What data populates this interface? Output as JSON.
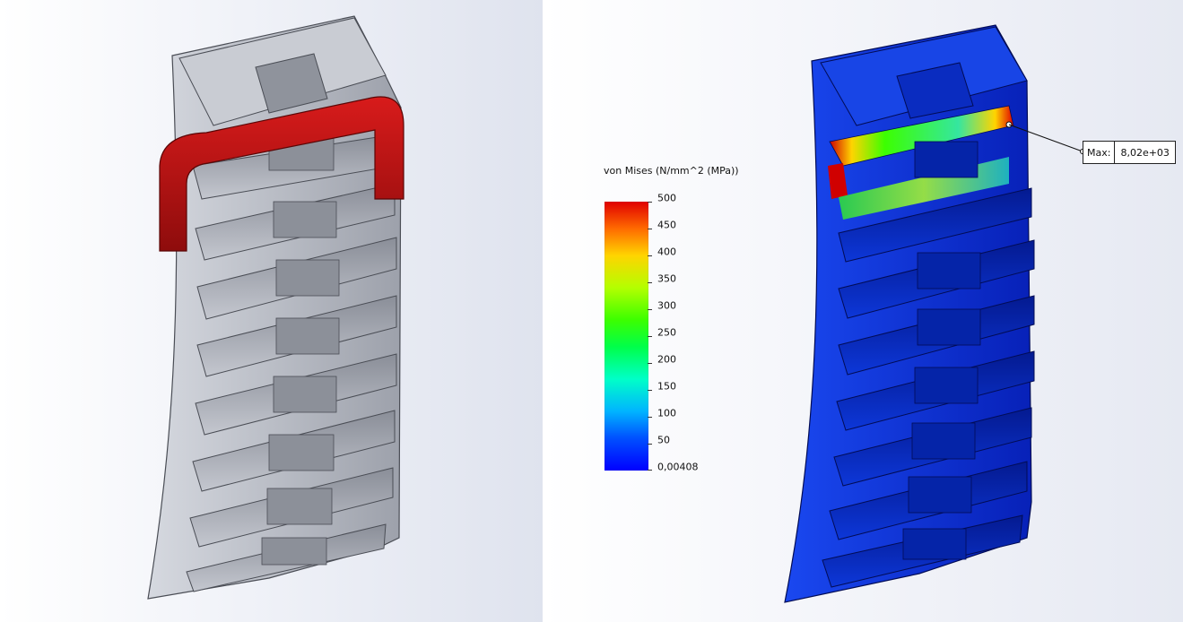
{
  "legend": {
    "title": "von Mises (N/mm^2 (MPa))",
    "labels": [
      "500",
      "450",
      "400",
      "350",
      "300",
      "250",
      "200",
      "150",
      "100",
      "50",
      "0,00408"
    ],
    "colors": {
      "max": "#e00000",
      "mid": "#3cff00",
      "min": "#0000ff"
    }
  },
  "max_annotation": {
    "label": "Max:",
    "value": "8,02e+03"
  },
  "model_colors": {
    "part_gray": "#b8bcc6",
    "load_red": "#c41414",
    "stress_blue": "#0a2fd6"
  }
}
